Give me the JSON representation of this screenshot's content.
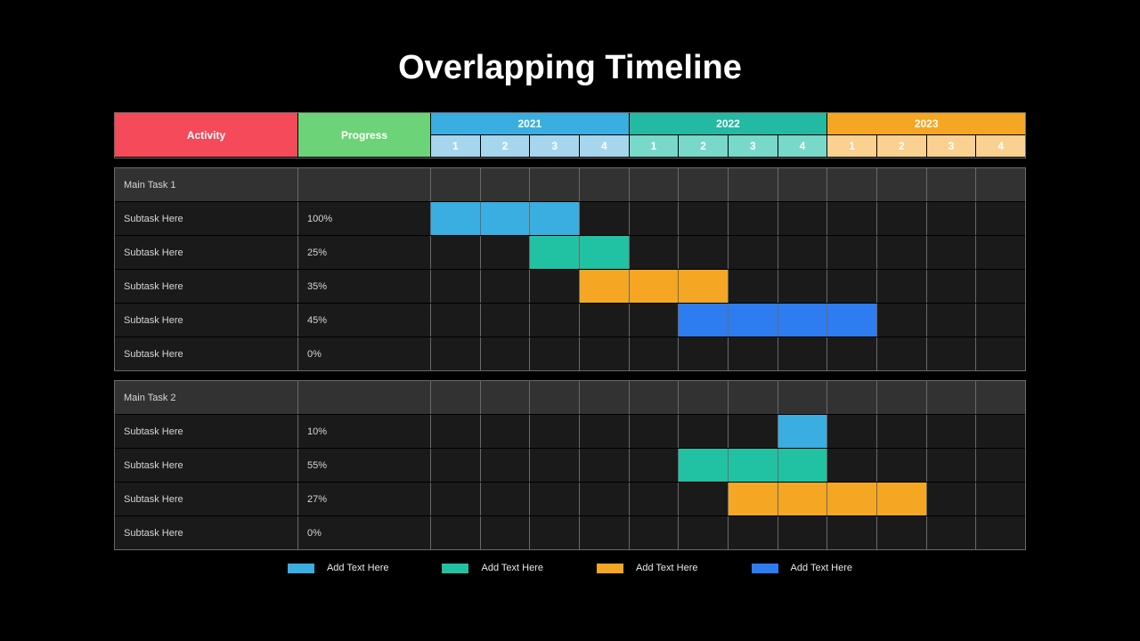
{
  "title": "Overlapping Timeline",
  "header": {
    "activity": "Activity",
    "progress": "Progress",
    "years": [
      "2021",
      "2022",
      "2023"
    ],
    "quarters": [
      "1",
      "2",
      "3",
      "4"
    ]
  },
  "sections": [
    {
      "main": "Main Task 1",
      "rows": [
        {
          "label": "Subtask Here",
          "progress": "100%",
          "bars": [
            {
              "start": 0,
              "end": 3,
              "color": "c-blue"
            }
          ]
        },
        {
          "label": "Subtask Here",
          "progress": "25%",
          "bars": [
            {
              "start": 2,
              "end": 4,
              "color": "c-teal"
            }
          ]
        },
        {
          "label": "Subtask Here",
          "progress": "35%",
          "bars": [
            {
              "start": 3,
              "end": 6,
              "color": "c-orange"
            }
          ]
        },
        {
          "label": "Subtask Here",
          "progress": "45%",
          "bars": [
            {
              "start": 5,
              "end": 9,
              "color": "c-royal"
            }
          ]
        },
        {
          "label": "Subtask Here",
          "progress": "0%",
          "bars": []
        }
      ]
    },
    {
      "main": "Main Task 2",
      "rows": [
        {
          "label": "Subtask Here",
          "progress": "10%",
          "bars": [
            {
              "start": 7,
              "end": 8,
              "color": "c-blue"
            }
          ]
        },
        {
          "label": "Subtask Here",
          "progress": "55%",
          "bars": [
            {
              "start": 5,
              "end": 8,
              "color": "c-teal"
            }
          ]
        },
        {
          "label": "Subtask Here",
          "progress": "27%",
          "bars": [
            {
              "start": 6,
              "end": 10,
              "color": "c-orange"
            }
          ]
        },
        {
          "label": "Subtask Here",
          "progress": "0%",
          "bars": []
        }
      ]
    }
  ],
  "legend": [
    {
      "color": "c-blue",
      "label": "Add Text Here"
    },
    {
      "color": "c-teal",
      "label": "Add Text Here"
    },
    {
      "color": "c-orange",
      "label": "Add Text Here"
    },
    {
      "color": "c-royal",
      "label": "Add Text Here"
    }
  ],
  "chart_data": {
    "type": "bar",
    "title": "Overlapping Timeline",
    "x_categories": [
      "2021-Q1",
      "2021-Q2",
      "2021-Q3",
      "2021-Q4",
      "2022-Q1",
      "2022-Q2",
      "2022-Q3",
      "2022-Q4",
      "2023-Q1",
      "2023-Q2",
      "2023-Q3",
      "2023-Q4"
    ],
    "groups": [
      {
        "name": "Main Task 1",
        "tasks": [
          {
            "name": "Subtask Here",
            "progress": 100,
            "start": "2021-Q1",
            "end": "2021-Q3",
            "series": "blue"
          },
          {
            "name": "Subtask Here",
            "progress": 25,
            "start": "2021-Q3",
            "end": "2021-Q4",
            "series": "teal"
          },
          {
            "name": "Subtask Here",
            "progress": 35,
            "start": "2021-Q4",
            "end": "2022-Q2",
            "series": "orange"
          },
          {
            "name": "Subtask Here",
            "progress": 45,
            "start": "2022-Q2",
            "end": "2023-Q1",
            "series": "royal"
          },
          {
            "name": "Subtask Here",
            "progress": 0,
            "start": null,
            "end": null,
            "series": null
          }
        ]
      },
      {
        "name": "Main Task 2",
        "tasks": [
          {
            "name": "Subtask Here",
            "progress": 10,
            "start": "2022-Q4",
            "end": "2022-Q4",
            "series": "blue"
          },
          {
            "name": "Subtask Here",
            "progress": 55,
            "start": "2022-Q2",
            "end": "2022-Q4",
            "series": "teal"
          },
          {
            "name": "Subtask Here",
            "progress": 27,
            "start": "2022-Q3",
            "end": "2023-Q2",
            "series": "orange"
          },
          {
            "name": "Subtask Here",
            "progress": 0,
            "start": null,
            "end": null,
            "series": null
          }
        ]
      }
    ],
    "series_colors": {
      "blue": "#3aaee0",
      "teal": "#21c2a3",
      "orange": "#f5a623",
      "royal": "#2d7cf0"
    }
  }
}
